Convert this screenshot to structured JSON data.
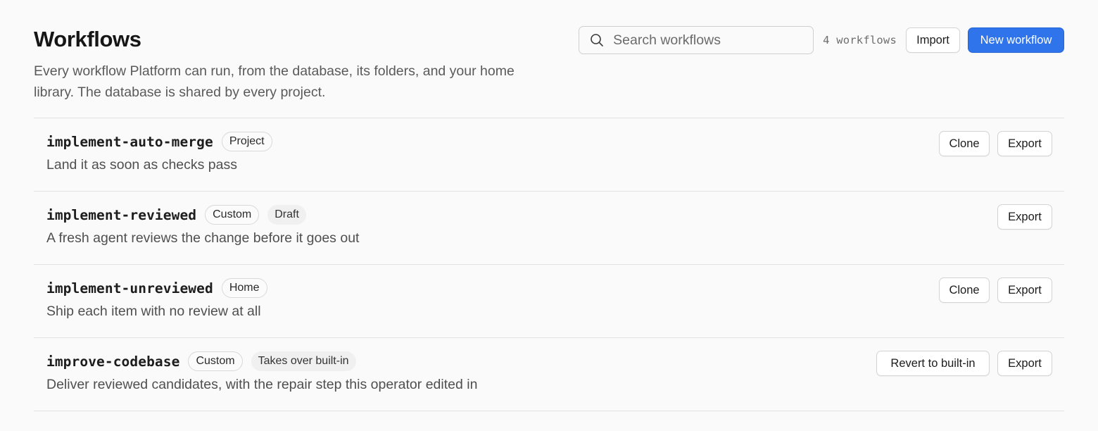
{
  "header": {
    "title": "Workflows",
    "subtitle": "Every workflow Platform can run, from the database, its folders, and your home library. The database is shared by every project.",
    "search_placeholder": "Search workflows",
    "count": "4 workflows",
    "import_label": "Import",
    "new_label": "New workflow",
    "accent_color": "#2f74ea"
  },
  "workflows": [
    {
      "name": "implement-auto-merge",
      "tags": [
        "Project"
      ],
      "description": "Land it as soon as checks pass",
      "actions": [
        "Clone",
        "Export"
      ]
    },
    {
      "name": "implement-reviewed",
      "tags": [
        "Custom",
        "Draft"
      ],
      "description": "A fresh agent reviews the change before it goes out",
      "actions": [
        "Export"
      ]
    },
    {
      "name": "implement-unreviewed",
      "tags": [
        "Home"
      ],
      "description": "Ship each item with no review at all",
      "actions": [
        "Clone",
        "Export"
      ]
    },
    {
      "name": "improve-codebase",
      "tags": [
        "Custom",
        "Takes over built-in"
      ],
      "description": "Deliver reviewed candidates, with the repair step this operator edited in",
      "actions": [
        "Revert to built-in",
        "Export"
      ]
    }
  ]
}
